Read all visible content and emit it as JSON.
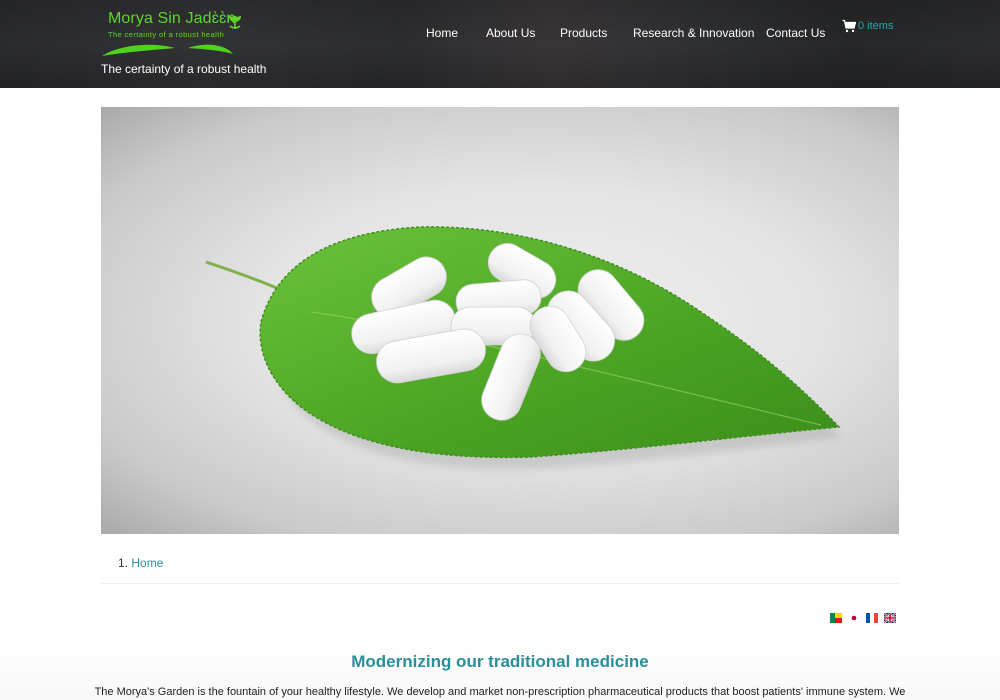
{
  "header": {
    "logo": {
      "name": "Morya Sin Jadɛ̀ɛ̀n",
      "subtitle": "The certainty of a robust health",
      "icon": "sprout-icon",
      "color": "#5fd62c"
    },
    "tagline": "The certainty of a robust health",
    "nav": [
      {
        "label": "Home"
      },
      {
        "label": "About Us"
      },
      {
        "label": "Products"
      },
      {
        "label": "Research & Innovation"
      },
      {
        "label": "Contact Us"
      }
    ],
    "cart": {
      "icon": "shopping-cart-icon",
      "label": "0 items",
      "color": "#2aa7a7"
    }
  },
  "hero": {
    "alt": "White pills on a green leaf"
  },
  "breadcrumb": {
    "items": [
      {
        "index": "1.",
        "label": "Home"
      }
    ]
  },
  "languages": [
    {
      "code": "bj",
      "icon": "benin-flag-icon"
    },
    {
      "code": "jp",
      "icon": "japan-flag-icon"
    },
    {
      "code": "fr",
      "icon": "france-flag-icon"
    },
    {
      "code": "en",
      "icon": "uk-flag-icon"
    }
  ],
  "section": {
    "title": "Modernizing our traditional medicine",
    "body": "The Morya's Garden is the fountain of your healthy lifestyle. We develop and market non-prescription pharmaceutical products that boost patients' immune system. We"
  },
  "colors": {
    "accent": "#2a8f99",
    "brand_green": "#5fd62c"
  }
}
